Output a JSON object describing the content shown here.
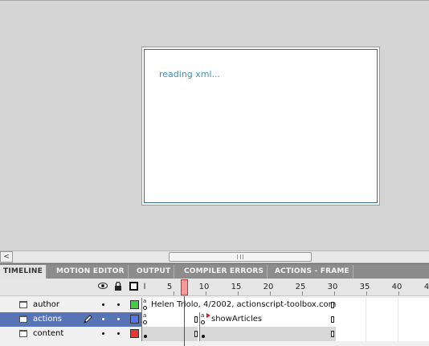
{
  "stage": {
    "text": "reading xml..."
  },
  "scrollbar": {
    "left_arrow": "<"
  },
  "tabs": [
    {
      "label": "TIMELINE",
      "active": true
    },
    {
      "label": "MOTION EDITOR",
      "active": false
    },
    {
      "label": "OUTPUT",
      "active": false
    },
    {
      "label": "COMPILER ERRORS",
      "active": false
    },
    {
      "label": "ACTIONS - FRAME",
      "active": false
    }
  ],
  "timeline": {
    "header_icons": {
      "frame_start": "l"
    },
    "ruler": [
      "5",
      "10",
      "15",
      "20",
      "25",
      "30",
      "35",
      "40",
      "4"
    ],
    "current_frame": 8,
    "layers": [
      {
        "name": "author",
        "color": "#44cc44",
        "selected": false,
        "frame_label": "Helen Triolo, 4/2002, actionscript-toolbox.com"
      },
      {
        "name": "actions",
        "color": "#5577ee",
        "selected": true,
        "frame_label": "showArticles"
      },
      {
        "name": "content",
        "color": "#ee3333",
        "selected": false,
        "frame_label": ""
      }
    ]
  },
  "icons": {
    "eye": "eye-icon",
    "lock": "lock-icon",
    "outline": "outline-icon",
    "pencil": "pencil-icon",
    "layer": "layer-icon"
  }
}
